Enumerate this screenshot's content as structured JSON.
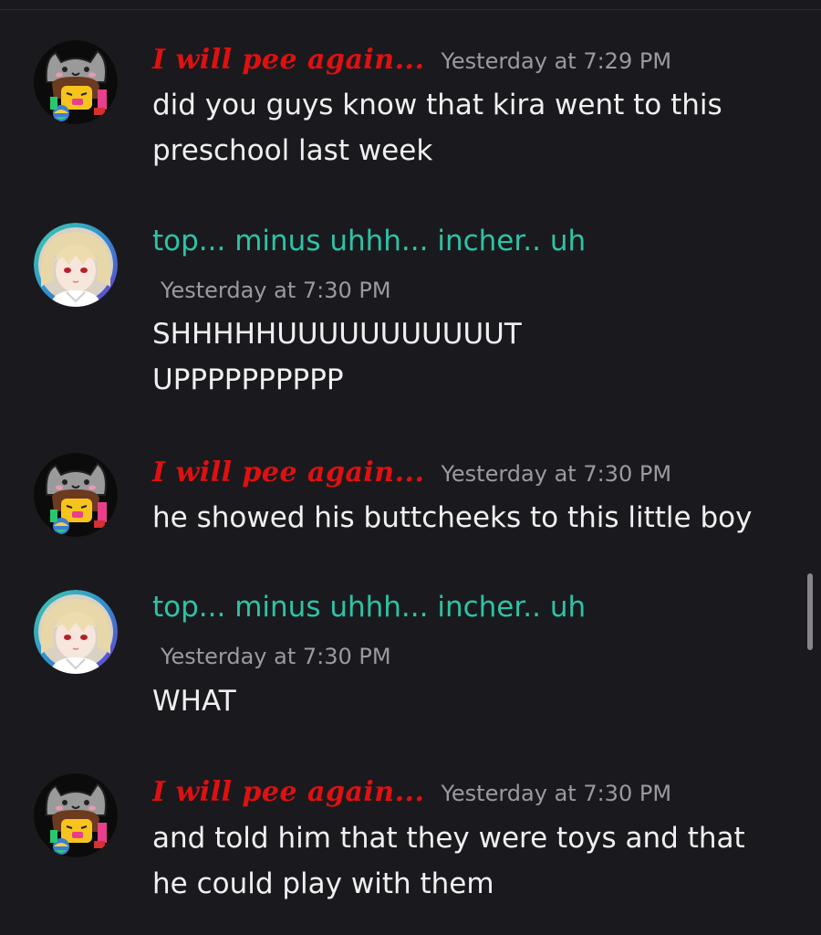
{
  "messages": [
    {
      "author": "I will pee again...",
      "author_style": "red",
      "avatar": "cat-hat-avatar",
      "timestamp": "Yesterday at 7:29 PM",
      "lines": [
        "did you guys know that kira went to this",
        "preschool last week"
      ]
    },
    {
      "author": "top... minus uhhh... incher.. uh",
      "author_style": "teal",
      "avatar": "blonde-girl-avatar",
      "timestamp": "Yesterday at 7:30 PM",
      "lines": [
        "SHHHHHUUUUUUUUUUUT",
        "UPPPPPPPPPP"
      ]
    },
    {
      "author": "I will pee again...",
      "author_style": "red",
      "avatar": "cat-hat-avatar",
      "timestamp": "Yesterday at 7:30 PM",
      "lines": [
        "he showed his buttcheeks to this little boy"
      ]
    },
    {
      "author": "top... minus uhhh... incher.. uh",
      "author_style": "teal",
      "avatar": "blonde-girl-avatar",
      "timestamp": "Yesterday at 7:30 PM",
      "lines": [
        "WHAT"
      ]
    },
    {
      "author": "I will pee again...",
      "author_style": "red",
      "avatar": "cat-hat-avatar",
      "timestamp": "Yesterday at 7:30 PM",
      "lines": [
        "and told him that they were toys and that",
        "he could play with them"
      ]
    }
  ],
  "colors": {
    "background": "#1a1a1e",
    "red_name": "#e01010",
    "teal_name": "#2dc3a6",
    "timestamp": "#9a9aa0",
    "text": "#f0f0f2"
  }
}
